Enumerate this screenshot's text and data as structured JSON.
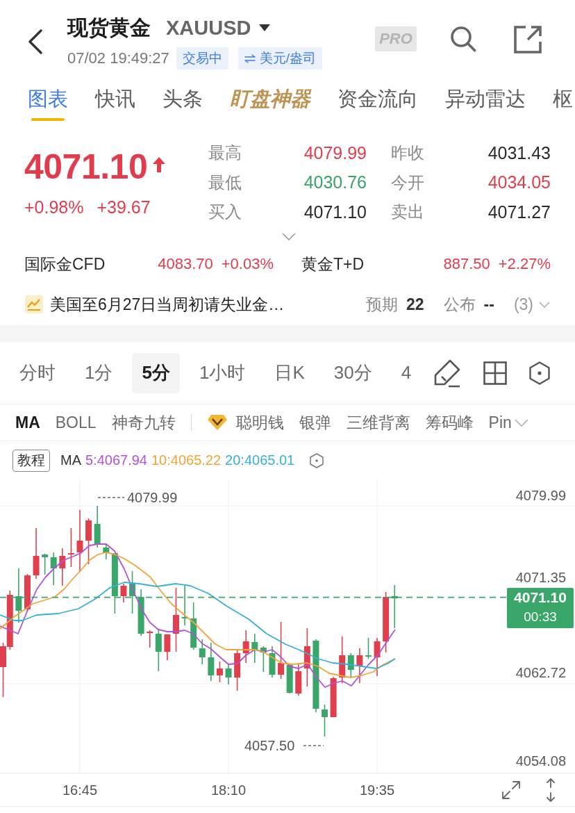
{
  "header": {
    "title": "现货黄金",
    "symbol": "XAUUSD",
    "time": "07/02 19:49:27",
    "status": "交易中",
    "unit": "美元/盎司",
    "pro": "PRO"
  },
  "tabs": [
    {
      "label": "图表",
      "selected": true,
      "kind": "plain"
    },
    {
      "label": "快讯",
      "selected": false,
      "kind": "plain"
    },
    {
      "label": "头条",
      "selected": false,
      "kind": "plain"
    },
    {
      "label": "盯盘神器",
      "selected": false,
      "kind": "featured"
    },
    {
      "label": "资金流向",
      "selected": false,
      "kind": "plain"
    },
    {
      "label": "异动雷达",
      "selected": false,
      "kind": "plain"
    },
    {
      "label": "枢",
      "selected": false,
      "kind": "plain"
    }
  ],
  "quote": {
    "price": "4071.10",
    "rising": true,
    "color": "#e03c4b",
    "change_percent": "+0.98%",
    "change": "+39.67"
  },
  "stats": [
    {
      "label": "最高",
      "value": "4079.99",
      "color": "#e03c4b"
    },
    {
      "label": "昨收",
      "value": "4031.43",
      "color": "#2a2a2a"
    },
    {
      "label": "最低",
      "value": "4030.76",
      "color": "#39a266"
    },
    {
      "label": "今开",
      "value": "4034.05",
      "color": "#e03c4b"
    },
    {
      "label": "买入",
      "value": "4071.10",
      "color": "#2a2a2a"
    },
    {
      "label": "卖出",
      "value": "4071.27",
      "color": "#2a2a2a"
    }
  ],
  "related": [
    {
      "name": "国际金CFD",
      "price": "4083.70",
      "change": "+0.03%",
      "color": "#e03c4b"
    },
    {
      "name": "黄金T+D",
      "price": "887.50",
      "change": "+2.27%",
      "color": "#e03c4b"
    }
  ],
  "event": {
    "title": "美国至6月27日当周初请失业金…",
    "expected_label": "预期",
    "expected": "22",
    "actual_label": "公布",
    "actual": "--",
    "count": "(3)"
  },
  "periods": [
    {
      "label": "分时",
      "selected": false
    },
    {
      "label": "1分",
      "selected": false
    },
    {
      "label": "5分",
      "selected": true
    },
    {
      "label": "1小时",
      "selected": false
    },
    {
      "label": "日K",
      "selected": false
    },
    {
      "label": "30分",
      "selected": false
    },
    {
      "label": "4",
      "selected": false
    }
  ],
  "indicators": [
    {
      "label": "MA",
      "selected": true,
      "kind": "plain"
    },
    {
      "label": "BOLL",
      "selected": false,
      "kind": "plain"
    },
    {
      "label": "神奇九转",
      "selected": false,
      "kind": "plain"
    },
    {
      "label": "聪明钱",
      "selected": false,
      "kind": "premium"
    },
    {
      "label": "银弹",
      "selected": false,
      "kind": "plain"
    },
    {
      "label": "三维背离",
      "selected": false,
      "kind": "plain"
    },
    {
      "label": "筹码峰",
      "selected": false,
      "kind": "plain"
    },
    {
      "label": "Pin",
      "selected": false,
      "kind": "plain"
    }
  ],
  "chart": {
    "tutorial": "教程",
    "ma_label": "MA",
    "ma": [
      {
        "text": "5:4067.94",
        "color": "#b352d6"
      },
      {
        "text": "10:4065.22",
        "color": "#f2a436"
      },
      {
        "text": "20:4065.01",
        "color": "#35b0d8"
      }
    ],
    "price_axis": [
      "4079.99",
      "4071.35",
      "4062.72",
      "4054.08"
    ],
    "high_marker": "4079.99",
    "low_marker": "4057.50",
    "price_tag": "4071.10",
    "countdown": "00:33",
    "time_axis": [
      "16:45",
      "18:10",
      "19:35"
    ]
  }
}
